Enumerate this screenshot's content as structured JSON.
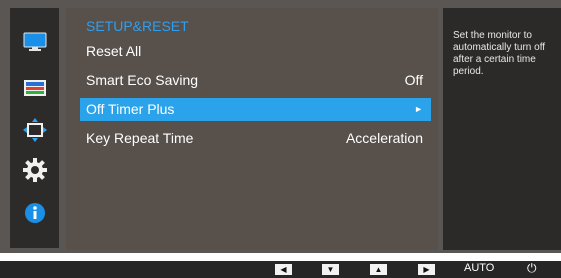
{
  "menu": {
    "title": "SETUP&RESET",
    "items": [
      {
        "label": "Reset All",
        "value": ""
      },
      {
        "label": "Smart Eco Saving",
        "value": "Off"
      },
      {
        "label": "Off Timer Plus",
        "value": ""
      },
      {
        "label": "Key Repeat Time",
        "value": "Acceleration"
      }
    ],
    "selected_index": 2
  },
  "help": {
    "text": "Set the monitor to automatically turn off after a certain time period."
  },
  "sidebar": {
    "icons": [
      "picture-icon",
      "color-icon",
      "size-position-icon",
      "setup-reset-gear-icon",
      "information-icon"
    ]
  },
  "footer": {
    "buttons": [
      "left-arrow",
      "down-arrow",
      "up-arrow",
      "right-arrow"
    ],
    "auto_label": "AUTO"
  },
  "colors": {
    "accent": "#2ba3ea",
    "title": "#2e9ff0",
    "panel": "#57504b",
    "frame": "#595653"
  }
}
